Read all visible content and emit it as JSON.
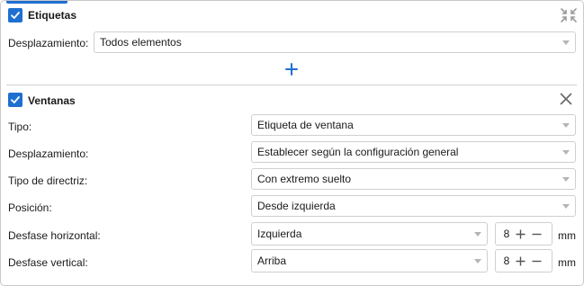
{
  "etiquetas": {
    "title": "Etiquetas",
    "checked": true,
    "desplazamiento_label": "Desplazamiento:",
    "desplazamiento_value": "Todos elementos",
    "collapse_icon": "collapse-arrows-icon",
    "add_icon": "plus-icon"
  },
  "ventanas": {
    "title": "Ventanas",
    "checked": true,
    "close_icon": "close-icon",
    "rows": [
      {
        "label": "Tipo:",
        "value": "Etiqueta de ventana"
      },
      {
        "label": "Desplazamiento:",
        "value": "Establecer según la configuración general"
      },
      {
        "label": "Tipo de directriz:",
        "value": "Con extremo suelto"
      },
      {
        "label": "Posición:",
        "value": "Desde izquierda"
      },
      {
        "label": "Desfase horizontal:",
        "value": "Izquierda",
        "stepper": "8",
        "unit": "mm"
      },
      {
        "label": "Desfase vertical:",
        "value": "Arriba",
        "stepper": "8",
        "unit": "mm"
      }
    ]
  },
  "colors": {
    "accent": "#1f6fd1",
    "border": "#cfcfcf"
  }
}
